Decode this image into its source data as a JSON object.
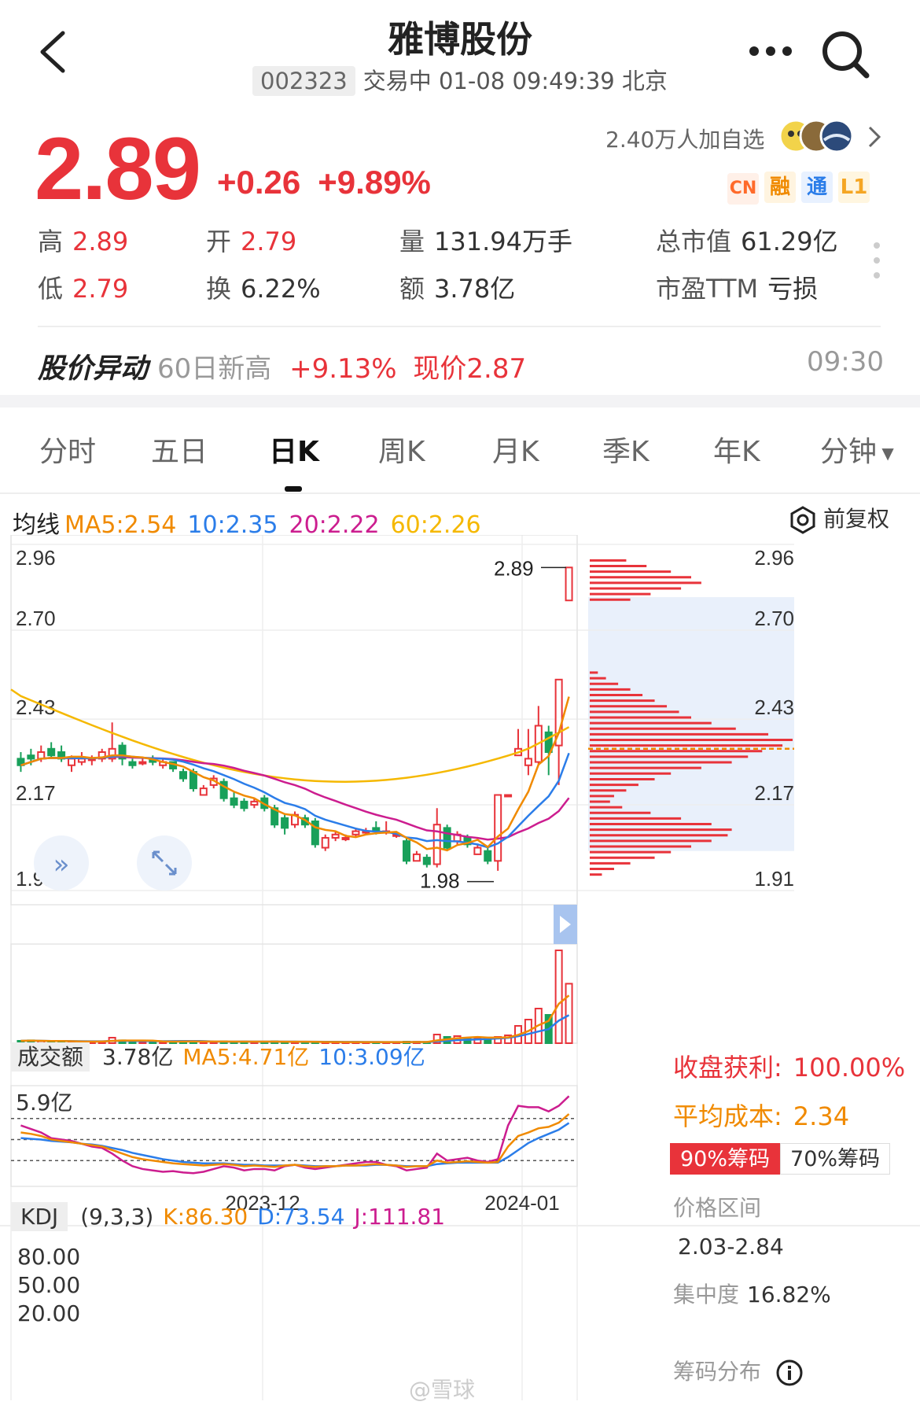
{
  "header": {
    "title": "雅博股份",
    "code": "002323",
    "status": "交易中 01-08 09:49:39 北京"
  },
  "quote": {
    "price": "2.89",
    "change": "+0.26",
    "change_pct": "+9.89%",
    "watchers": "2.40万人加自选",
    "tags": [
      "CN",
      "融",
      "通",
      "L1"
    ],
    "tag_colors": [
      "#ff6a2a",
      "#f08a00",
      "#2b7de9",
      "#f5a623"
    ],
    "high_label": "高",
    "high": "2.89",
    "low_label": "低",
    "low": "2.79",
    "open_label": "开",
    "open": "2.79",
    "turnover_label": "换",
    "turnover": "6.22%",
    "volume_label": "量",
    "volume": "131.94万手",
    "amount_label": "额",
    "amount": "3.78亿",
    "mktcap_label": "总市值",
    "mktcap": "61.29亿",
    "pe_label": "市盈TTM",
    "pe": "亏损"
  },
  "alert": {
    "title": "股价异动",
    "text": "60日新高",
    "pct": "+9.13%",
    "now": "现价2.87",
    "time": "09:30"
  },
  "tabs": [
    "分时",
    "五日",
    "日K",
    "周K",
    "月K",
    "季K",
    "年K",
    "分钟"
  ],
  "active_tab": "日K",
  "ma": {
    "label": "均线",
    "ma5": "MA5:2.54",
    "ma10": "10:2.35",
    "ma20": "20:2.22",
    "ma60": "60:2.26",
    "adjust": "前复权"
  },
  "colors": {
    "up": "#e8333a",
    "down": "#19a05a",
    "ma5": "#f08a00",
    "ma10": "#2b7de9",
    "ma20": "#cc1d8f",
    "ma60": "#f5b800"
  },
  "volume": {
    "label": "成交额",
    "value": "3.78亿",
    "ma5": "MA5:4.71亿",
    "ma10": "10:3.09亿",
    "max": "5.9亿"
  },
  "kdj": {
    "label": "KDJ",
    "params": "(9,3,3)",
    "k": "K:86.30",
    "d": "D:73.54",
    "j": "J:111.81",
    "levels": [
      "80.00",
      "50.00",
      "20.00"
    ]
  },
  "chips": {
    "profit_label": "收盘获利:",
    "profit": "100.00%",
    "cost_label": "平均成本:",
    "cost": "2.34",
    "btn90": "90%筹码",
    "btn70": "70%筹码",
    "range_label": "价格区间",
    "range": "2.03-2.84",
    "conc_label": "集中度",
    "conc": "16.82%",
    "footer": "筹码分布"
  },
  "watermark": "@雪球",
  "chart_data": {
    "type": "candlestick",
    "y_axis_labels": [
      "2.96",
      "2.70",
      "2.43",
      "2.17",
      "1.91"
    ],
    "ylim": [
      1.91,
      2.96
    ],
    "x_labels": [
      "2023-12",
      "2024-01"
    ],
    "annotations": {
      "high": "2.89",
      "low": "1.98"
    },
    "candles": [
      [
        2.31,
        2.29,
        2.33,
        2.27
      ],
      [
        2.32,
        2.31,
        2.34,
        2.29
      ],
      [
        2.31,
        2.33,
        2.35,
        2.3
      ],
      [
        2.34,
        2.32,
        2.36,
        2.31
      ],
      [
        2.33,
        2.31,
        2.35,
        2.3
      ],
      [
        2.29,
        2.31,
        2.32,
        2.27
      ],
      [
        2.3,
        2.31,
        2.33,
        2.29
      ],
      [
        2.31,
        2.31,
        2.32,
        2.29
      ],
      [
        2.31,
        2.33,
        2.34,
        2.3
      ],
      [
        2.31,
        2.34,
        2.42,
        2.3
      ],
      [
        2.35,
        2.31,
        2.36,
        2.29
      ],
      [
        2.3,
        2.29,
        2.31,
        2.28
      ],
      [
        2.3,
        2.3,
        2.31,
        2.29
      ],
      [
        2.31,
        2.3,
        2.32,
        2.29
      ],
      [
        2.29,
        2.3,
        2.31,
        2.28
      ],
      [
        2.3,
        2.28,
        2.3,
        2.27
      ],
      [
        2.27,
        2.25,
        2.28,
        2.24
      ],
      [
        2.27,
        2.22,
        2.28,
        2.21
      ],
      [
        2.2,
        2.22,
        2.23,
        2.2
      ],
      [
        2.23,
        2.25,
        2.26,
        2.22
      ],
      [
        2.24,
        2.19,
        2.25,
        2.18
      ],
      [
        2.19,
        2.17,
        2.21,
        2.16
      ],
      [
        2.18,
        2.16,
        2.19,
        2.15
      ],
      [
        2.17,
        2.18,
        2.19,
        2.16
      ],
      [
        2.19,
        2.16,
        2.2,
        2.15
      ],
      [
        2.16,
        2.11,
        2.17,
        2.1
      ],
      [
        2.13,
        2.1,
        2.14,
        2.08
      ],
      [
        2.11,
        2.14,
        2.15,
        2.1
      ],
      [
        2.13,
        2.11,
        2.14,
        2.1
      ],
      [
        2.12,
        2.05,
        2.13,
        2.04
      ],
      [
        2.04,
        2.07,
        2.08,
        2.03
      ],
      [
        2.07,
        2.08,
        2.09,
        2.06
      ],
      [
        2.07,
        2.07,
        2.08,
        2.06
      ],
      [
        2.08,
        2.09,
        2.1,
        2.07
      ],
      [
        2.09,
        2.09,
        2.1,
        2.08
      ],
      [
        2.1,
        2.09,
        2.12,
        2.08
      ],
      [
        2.09,
        2.09,
        2.12,
        2.08
      ],
      [
        2.08,
        2.08,
        2.09,
        2.07
      ],
      [
        2.06,
        2.0,
        2.07,
        1.99
      ],
      [
        2.0,
        2.02,
        2.03,
        2.0
      ],
      [
        2.01,
        1.99,
        2.02,
        1.98
      ],
      [
        1.99,
        2.11,
        2.16,
        1.98
      ],
      [
        2.1,
        2.04,
        2.11,
        2.03
      ],
      [
        2.06,
        2.08,
        2.09,
        2.05
      ],
      [
        2.07,
        2.05,
        2.08,
        2.04
      ],
      [
        2.02,
        2.04,
        2.05,
        2.02
      ],
      [
        2.03,
        2.0,
        2.04,
        1.99
      ],
      [
        2.0,
        2.2,
        2.2,
        1.97
      ],
      [
        2.2,
        2.2,
        2.2,
        2.2
      ],
      [
        2.32,
        2.34,
        2.4,
        2.32
      ],
      [
        2.29,
        2.31,
        2.4,
        2.26
      ],
      [
        2.3,
        2.41,
        2.47,
        2.29
      ],
      [
        2.39,
        2.33,
        2.41,
        2.26
      ],
      [
        2.35,
        2.55,
        2.55,
        2.23
      ],
      [
        2.79,
        2.89,
        2.89,
        2.79
      ]
    ],
    "volume_values": [
      0.15,
      0.18,
      0.12,
      0.1,
      0.14,
      0.08,
      0.1,
      0.08,
      0.12,
      0.35,
      0.18,
      0.1,
      0.08,
      0.09,
      0.1,
      0.12,
      0.14,
      0.1,
      0.08,
      0.1,
      0.12,
      0.1,
      0.09,
      0.08,
      0.1,
      0.12,
      0.08,
      0.1,
      0.07,
      0.06,
      0.08,
      0.07,
      0.06,
      0.08,
      0.06,
      0.07,
      0.06,
      0.06,
      0.1,
      0.09,
      0.08,
      0.55,
      0.4,
      0.45,
      0.3,
      0.28,
      0.35,
      0.4,
      0.5,
      1.1,
      1.5,
      2.2,
      1.8,
      5.9,
      3.78
    ],
    "k_values": [
      60,
      58,
      55,
      50,
      48,
      46,
      44,
      42,
      40,
      35,
      30,
      25,
      22,
      20,
      18,
      16,
      15,
      14,
      13,
      14,
      15,
      14,
      12,
      13,
      12,
      11,
      13,
      14,
      12,
      11,
      12,
      12,
      13,
      13,
      14,
      15,
      14,
      13,
      11,
      12,
      12,
      20,
      17,
      18,
      19,
      18,
      17,
      18,
      40,
      55,
      60,
      66,
      68,
      74,
      86.3
    ],
    "d_values": [
      52,
      51,
      50,
      48,
      47,
      46,
      44,
      43,
      41,
      38,
      35,
      31,
      28,
      25,
      22,
      20,
      18,
      17,
      16,
      16,
      16,
      15,
      14,
      14,
      13,
      13,
      13,
      14,
      13,
      12,
      12,
      12,
      13,
      13,
      13,
      14,
      14,
      13,
      12,
      12,
      12,
      15,
      16,
      17,
      17,
      17,
      17,
      17,
      25,
      35,
      45,
      52,
      58,
      64,
      73.54
    ],
    "j_values": [
      70,
      65,
      60,
      52,
      50,
      48,
      44,
      40,
      38,
      30,
      20,
      12,
      8,
      6,
      4,
      5,
      3,
      2,
      4,
      8,
      12,
      10,
      6,
      8,
      8,
      6,
      12,
      14,
      10,
      8,
      10,
      12,
      14,
      16,
      18,
      18,
      14,
      12,
      6,
      8,
      10,
      30,
      20,
      22,
      24,
      20,
      18,
      22,
      70,
      98,
      96,
      96,
      90,
      98,
      111.81
    ],
    "chip_distribution": [
      0.18,
      0.28,
      0.4,
      0.5,
      0.55,
      0.45,
      0.3,
      0.2,
      0,
      0,
      0,
      0,
      0,
      0,
      0,
      0,
      0,
      0,
      0,
      0,
      0.04,
      0.08,
      0.14,
      0.2,
      0.26,
      0.32,
      0.38,
      0.44,
      0.5,
      0.6,
      0.72,
      0.88,
      1.0,
      0.95,
      0.85,
      0.78,
      0.7,
      0.55,
      0.4,
      0.32,
      0.24,
      0.18,
      0.12,
      0.1,
      0.16,
      0.3,
      0.45,
      0.6,
      0.7,
      0.68,
      0.6,
      0.5,
      0.4,
      0.32,
      0.2,
      0.12,
      0.06
    ],
    "chip_range": [
      1.95,
      2.92
    ]
  }
}
